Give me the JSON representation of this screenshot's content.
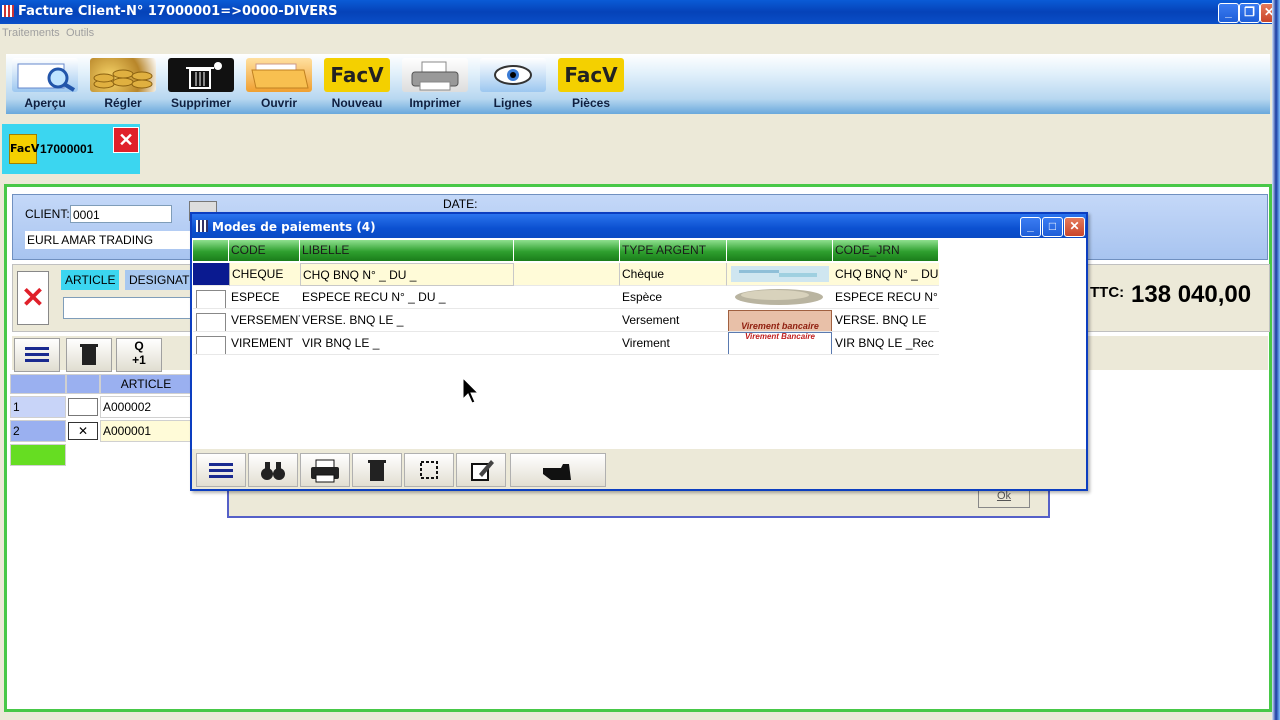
{
  "window": {
    "title": "Facture Client-N° 17000001=>0000-DIVERS"
  },
  "menu": [
    "Traitements",
    "Outils"
  ],
  "toolbar": [
    {
      "label": "Aperçu",
      "icon": "magnifier-preview-icon"
    },
    {
      "label": "Régler",
      "icon": "coins-icon"
    },
    {
      "label": "Supprimer",
      "icon": "trash-icon"
    },
    {
      "label": "Ouvrir",
      "icon": "folder-icon"
    },
    {
      "label": "Nouveau",
      "icon": "facv-icon",
      "badge": "FacV"
    },
    {
      "label": "Imprimer",
      "icon": "printer-icon"
    },
    {
      "label": "Lignes",
      "icon": "eye-icon"
    },
    {
      "label": "Pièces",
      "icon": "facv-icon",
      "badge": "FacV"
    }
  ],
  "doc_tab": {
    "badge": "FacV",
    "number": "17000001"
  },
  "client": {
    "label": "CLIENT:",
    "code": "0001",
    "name": "EURL AMAR TRADING",
    "date_label": "DATE:"
  },
  "article": {
    "tab1": "ARTICLE",
    "tab2": "DESIGNAT"
  },
  "ttc": {
    "label": "TTC:",
    "value": "138 040,00"
  },
  "grid_bg": {
    "header": "ARTICLE",
    "rows": [
      {
        "n": "1",
        "code": "A000002"
      },
      {
        "n": "2",
        "code": "A000001"
      }
    ]
  },
  "dialog": {
    "title": "Modes de paiements (4)",
    "columns": [
      "CODE",
      "LIBELLE",
      "",
      "TYPE ARGENT",
      "",
      "CODE_JRN"
    ],
    "rows": [
      {
        "code": "CHEQUE",
        "libelle": "CHQ BNQ  N° _ DU _",
        "type": "Chèque",
        "jrn": "CHQ BNQ  N° _ DU"
      },
      {
        "code": "ESPECE",
        "libelle": "ESPECE RECU N° _ DU _",
        "type": "Espèce",
        "jrn": "ESPECE RECU N°"
      },
      {
        "code": "VERSEMENT",
        "libelle": "VERSE. BNQ  LE _",
        "type": "Versement",
        "jrn": "VERSE. BNQ  LE"
      },
      {
        "code": "VIREMENT",
        "libelle": "VIR BNQ  LE _",
        "type": "Virement",
        "jrn": "VIR BNQ  LE _Rec"
      }
    ],
    "img_text_versement": "Virement bancaire",
    "img_text_virement": "Virement Bancaire",
    "ok": "Ok"
  }
}
